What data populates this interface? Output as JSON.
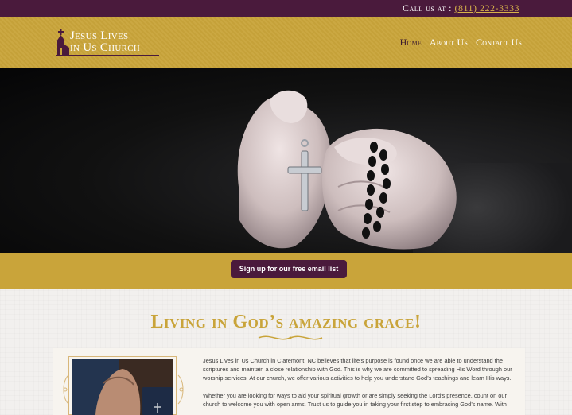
{
  "topbar": {
    "call_label": "Call us at : ",
    "phone": "(811) 222-3333"
  },
  "logo": {
    "line1": "Jesus Lives",
    "line2": "in Us Church"
  },
  "nav": [
    {
      "label": "Home"
    },
    {
      "label": "About Us"
    },
    {
      "label": "Contact Us"
    }
  ],
  "cta": {
    "signup_label": "Sign up for our free email list"
  },
  "main": {
    "heading": "Living in God’s amazing grace!",
    "paragraphs": [
      "Jesus Lives in Us Church in Claremont, NC believes that life’s purpose is found once we are able to understand the scriptures and maintain a close relationship with God. This is why we are committed to spreading His Word through our worship services. At our church, we offer various activities to help you understand God’s teachings and learn His ways.",
      "Whether you are looking for ways to aid your spiritual growth or are simply seeking the Lord’s presence, count on our church to welcome you with open arms. Trust us to guide you in taking your first step to embracing God’s name. With"
    ]
  },
  "colors": {
    "plum": "#4a1a3c",
    "gold": "#c9a43a"
  }
}
